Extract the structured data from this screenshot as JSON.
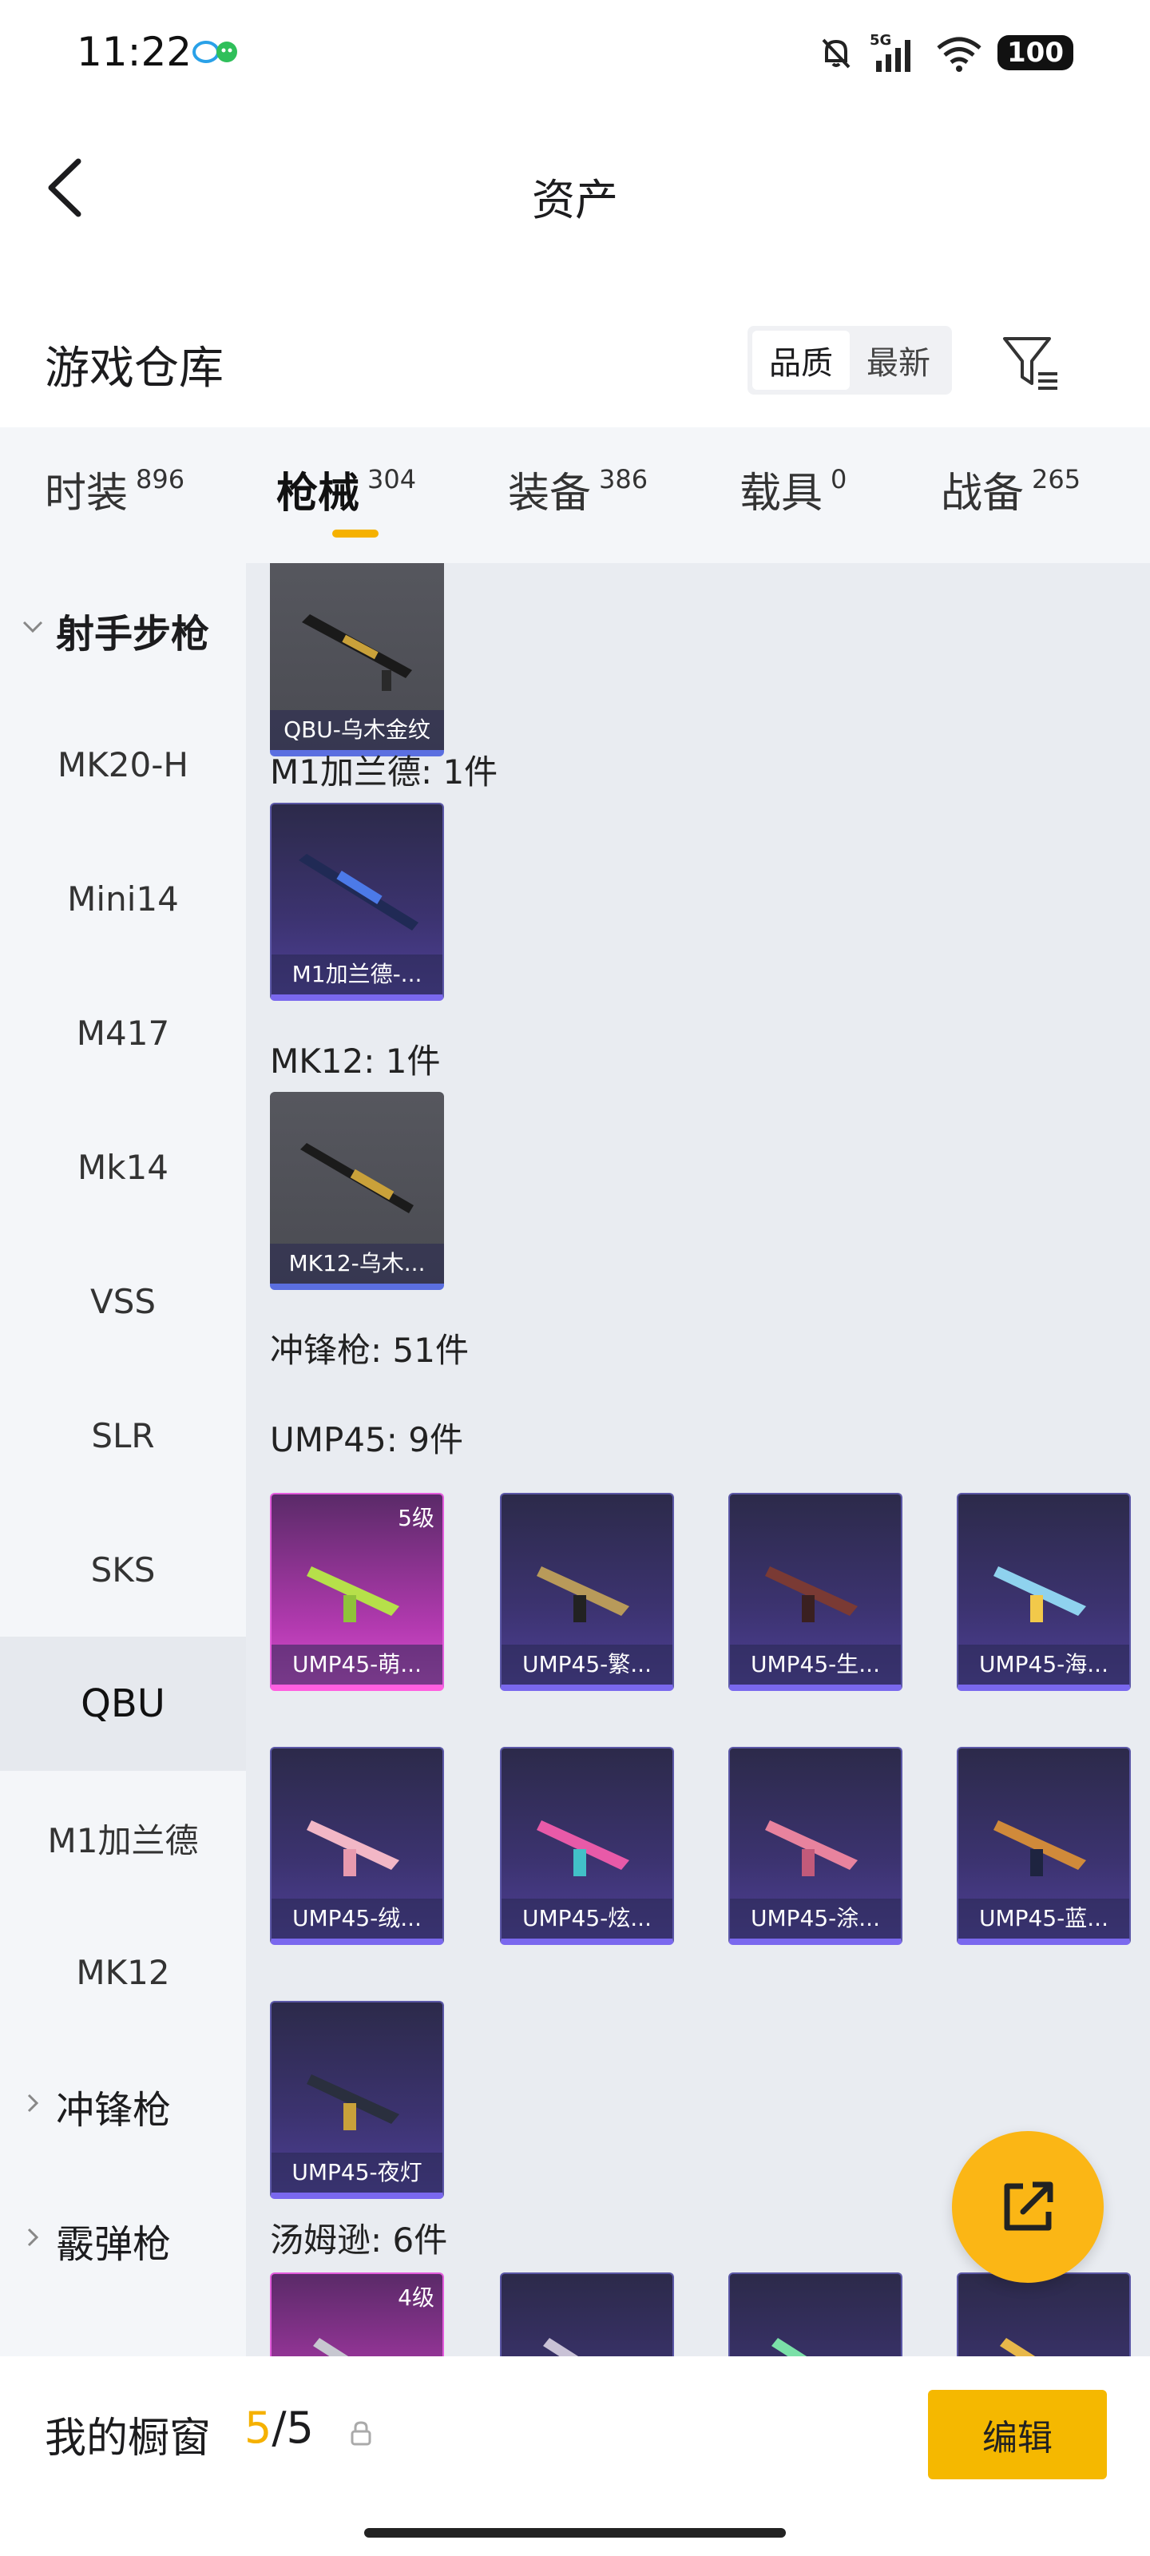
{
  "status_bar": {
    "time": "11:22",
    "network": "5G",
    "battery": "100"
  },
  "header": {
    "title": "资产"
  },
  "warehouse": {
    "title": "游戏仓库",
    "sort_options": [
      "品质",
      "最新"
    ],
    "active_sort": "品质"
  },
  "tabs": [
    {
      "label": "时装",
      "count": "896"
    },
    {
      "label": "枪械",
      "count": "304"
    },
    {
      "label": "装备",
      "count": "386"
    },
    {
      "label": "载具",
      "count": "0"
    },
    {
      "label": "战备",
      "count": "265"
    }
  ],
  "active_tab": "枪械",
  "sidebar": {
    "items": [
      {
        "label": "射手步枪",
        "type": "group-open"
      },
      {
        "label": "MK20-H"
      },
      {
        "label": "Mini14"
      },
      {
        "label": "M417"
      },
      {
        "label": "Mk14"
      },
      {
        "label": "VSS"
      },
      {
        "label": "SLR"
      },
      {
        "label": "SKS"
      },
      {
        "label": "QBU",
        "selected": true
      },
      {
        "label": "M1加兰德"
      },
      {
        "label": "MK12"
      },
      {
        "label": "冲锋枪",
        "type": "group-closed"
      },
      {
        "label": "霰弹枪",
        "type": "group-closed"
      }
    ]
  },
  "content": {
    "sections": [
      {
        "label": "",
        "items": [
          {
            "name": "QBU-乌木金纹",
            "quality": "gray"
          }
        ]
      },
      {
        "label": "M1加兰德: 1件",
        "items": [
          {
            "name": "M1加兰德-...",
            "quality": "purple"
          }
        ]
      },
      {
        "label": "MK12: 1件",
        "items": [
          {
            "name": "MK12-乌木...",
            "quality": "gray"
          }
        ]
      },
      {
        "label": "冲锋枪: 51件",
        "items": []
      },
      {
        "label": "UMP45: 9件",
        "items": [
          {
            "name": "UMP45-萌...",
            "quality": "pink",
            "level": "5级"
          },
          {
            "name": "UMP45-繁...",
            "quality": "purple"
          },
          {
            "name": "UMP45-生...",
            "quality": "purple"
          },
          {
            "name": "UMP45-海...",
            "quality": "purple"
          },
          {
            "name": "UMP45-绒...",
            "quality": "purple"
          },
          {
            "name": "UMP45-炫...",
            "quality": "purple"
          },
          {
            "name": "UMP45-涂...",
            "quality": "purple"
          },
          {
            "name": "UMP45-蓝...",
            "quality": "purple"
          },
          {
            "name": "UMP45-夜灯",
            "quality": "purple"
          }
        ]
      },
      {
        "label": "汤姆逊: 6件",
        "items": [
          {
            "name": "",
            "quality": "pink",
            "level": "4级"
          },
          {
            "name": "",
            "quality": "purple"
          },
          {
            "name": "",
            "quality": "purple"
          },
          {
            "name": "",
            "quality": "purple"
          }
        ]
      }
    ]
  },
  "showcase": {
    "label": "我的橱窗",
    "current": "5",
    "total": "/5",
    "edit_label": "编辑"
  },
  "colors": {
    "accent": "#f5b800",
    "tab_underline": "#f5b100",
    "fab": "#fbb615"
  },
  "icons": [
    "back-arrow-icon",
    "filter-icon",
    "chevron-down-icon",
    "chevron-right-icon",
    "share-icon",
    "lock-icon"
  ]
}
